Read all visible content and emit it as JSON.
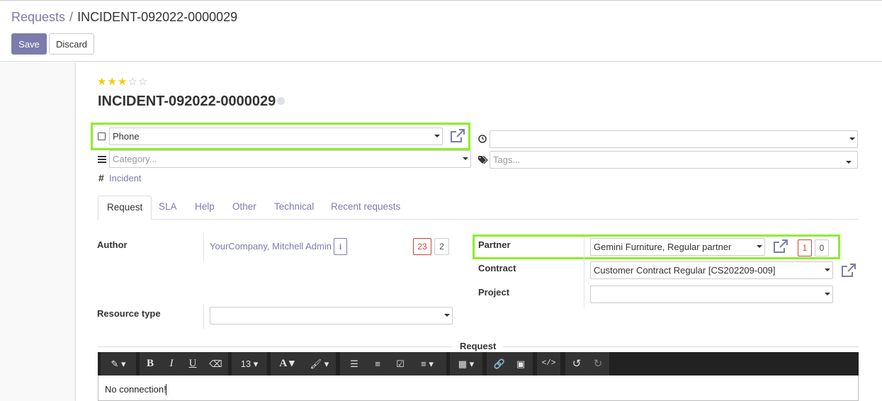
{
  "breadcrumb": {
    "parent": "Requests",
    "separator": "/",
    "current": "INCIDENT-092022-0000029"
  },
  "buttons": {
    "save": "Save",
    "discard": "Discard"
  },
  "rating": {
    "value": 3,
    "max": 5
  },
  "record": {
    "title": "INCIDENT-092022-0000029"
  },
  "fields": {
    "channel": {
      "value": "Phone"
    },
    "deadline": {
      "value": ""
    },
    "category": {
      "placeholder": "Category..."
    },
    "tags": {
      "placeholder": "Tags..."
    },
    "type": {
      "hash": "#",
      "value": "Incident"
    }
  },
  "tabs": [
    "Request",
    "SLA",
    "Help",
    "Other",
    "Technical",
    "Recent requests"
  ],
  "request_tab": {
    "author_label": "Author",
    "author_value": "YourCompany, Mitchell Admin",
    "author_info": "i",
    "author_badge_red": "23",
    "author_badge": "2",
    "partner_label": "Partner",
    "partner_value": "Gemini Furniture, Regular partner",
    "partner_badge_red": "1",
    "partner_badge": "0",
    "contract_label": "Contract",
    "contract_value": "Customer Contract Regular [CS202209-009]",
    "project_label": "Project",
    "project_value": "",
    "resource_label": "Resource type",
    "resource_value": "",
    "request_section": "Request"
  },
  "toolbar": {
    "font_size": "13"
  },
  "editor": {
    "content": "No connection!"
  },
  "colors": {
    "accent": "#7c7bad",
    "highlight": "#8ded2f",
    "danger": "#d23f3a",
    "star": "#f3cc00"
  }
}
